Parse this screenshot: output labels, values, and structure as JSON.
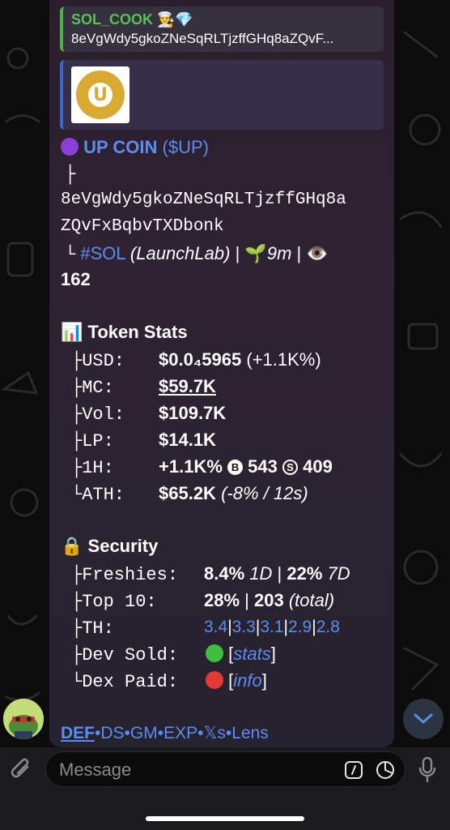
{
  "reply": {
    "sender": "SOL_COOK 👨‍🍳💎",
    "text": "8eVgWdy5gkoZNeSqRLTjzffGHq8aZQvF..."
  },
  "preview": {
    "logo_letter": "U"
  },
  "token": {
    "name": "UP COIN",
    "ticker": "($UP)",
    "branch1": "├",
    "address_line1": "8eVgWdy5gkoZNeSqRLTjzffGHq8a",
    "address_line2": "ZQvFxBqbvTXDbonk",
    "branch2": "└",
    "chain": "#SOL",
    "platform": "(LaunchLab)",
    "sep1": "|",
    "age_emoji": "🌱",
    "age": "9m",
    "sep2": "|",
    "views_emoji": "👁️",
    "views": "162"
  },
  "stats": {
    "title_emoji": "📊",
    "title": "Token Stats",
    "rows": [
      {
        "prefix": "├",
        "key": "USD:",
        "value": "$0.0₄5965",
        "extra": " (+1.1K%)"
      },
      {
        "prefix": "├",
        "key": "MC:",
        "value": "$59.7K"
      },
      {
        "prefix": "├",
        "key": "Vol:",
        "value": "$109.7K"
      },
      {
        "prefix": "├",
        "key": "LP:",
        "value": "$14.1K"
      },
      {
        "prefix": "├",
        "key": "1H:",
        "value": "+1.1K%",
        "b_icon": "B",
        "buys": "543",
        "s_icon": "S",
        "sells": "409"
      },
      {
        "prefix": "└",
        "key": "ATH:",
        "value": "$65.2K",
        "extra": "(-8% / 12s)"
      }
    ]
  },
  "security": {
    "title_emoji": "🔒",
    "title": "Security",
    "rows": [
      {
        "prefix": "├",
        "key": "Freshies:",
        "v1": "8.4%",
        "v1b": "1D",
        "sep": "|",
        "v2": "22%",
        "v2b": "7D"
      },
      {
        "prefix": "├",
        "key": "Top 10:",
        "v1": "28%",
        "sep": "|",
        "v2": "203",
        "v2b": "(total)"
      },
      {
        "prefix": "├",
        "key": "TH:",
        "holders": [
          "3.4",
          "3.3",
          "3.1",
          "2.9",
          "2.8"
        ],
        "sep": "|"
      },
      {
        "prefix": "├",
        "key": "Dev Sold:",
        "status_color": "#3fbf3f",
        "open": "[",
        "link": "stats",
        "close": "]"
      },
      {
        "prefix": "└",
        "key": "Dex Paid:",
        "status_color": "#e53935",
        "open": "[",
        "link": "info",
        "close": "]"
      }
    ]
  },
  "links": [
    "DEF",
    "DS",
    "GM",
    "EXP",
    "𝕏s",
    "Lens"
  ],
  "link_sep": "•",
  "input": {
    "placeholder": "Message"
  },
  "colors": {
    "accent": "#5b8def",
    "green": "#3fbf3f",
    "red": "#e53935",
    "name_green": "#56c256"
  }
}
